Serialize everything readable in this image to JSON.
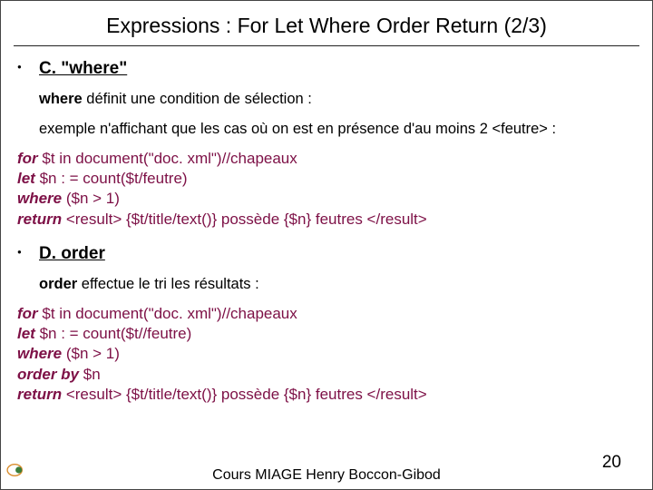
{
  "title": "Expressions : For Let Where Order Return (2/3)",
  "sectionC": {
    "heading": "C. \"where\"",
    "line1_pre": "where",
    "line1_rest": " définit une condition de sélection :",
    "line2": "exemple n'affichant que les cas où on est en présence d'au moins 2 <feutre> :"
  },
  "codeC": {
    "kw1": "for",
    "l1": " $t in document(\"doc. xml\")//chapeaux",
    "kw2": "let",
    "l2": " $n : = count($t/feutre)",
    "kw3": "where",
    "l3": " ($n > 1)",
    "kw4": "return",
    "l4": " <result> {$t/title/text()} possède {$n} feutres </result>"
  },
  "sectionD": {
    "heading": "D. order",
    "line1_pre": "order",
    "line1_rest": " effectue le tri les résultats :"
  },
  "codeD": {
    "kw1": "for",
    "l1": " $t in document(\"doc. xml\")//chapeaux",
    "kw2": "let",
    "l2": " $n : = count($t//feutre)",
    "kw3": "where",
    "l3": " ($n > 1)",
    "kw4": "order by",
    "l4": " $n",
    "kw5": "return",
    "l5": " <result> {$t/title/text()} possède {$n} feutres </result>"
  },
  "footer": {
    "center": "Cours MIAGE   Henry Boccon-Gibod",
    "page": "20"
  }
}
